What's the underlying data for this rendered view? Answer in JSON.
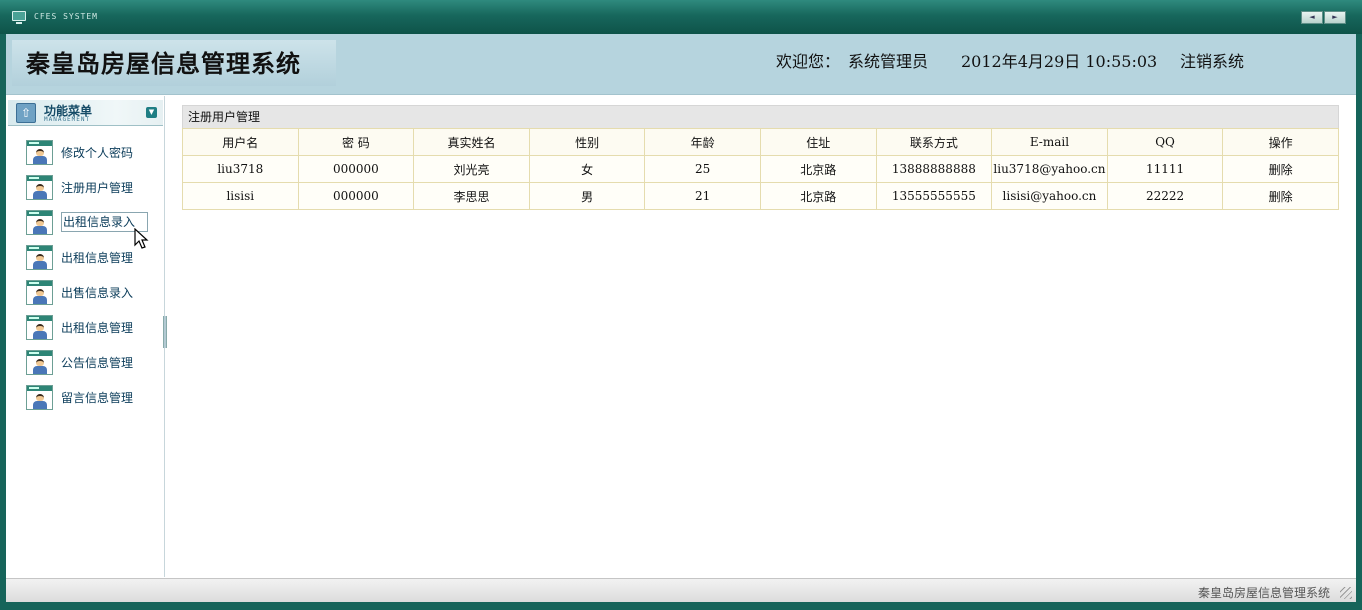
{
  "titlebar": {
    "system_name": "CFES SYSTEM",
    "prev": "◄",
    "next": "►"
  },
  "header": {
    "app_title": "秦皇岛房屋信息管理系统",
    "welcome_label": "欢迎您：",
    "user_name": "系统管理员",
    "datetime": "2012年4月29日  10:55:03",
    "logout": "注销系统"
  },
  "sidebar": {
    "menu_title": "功能菜单",
    "menu_subtitle": "MANAGEMENT",
    "items": [
      {
        "label": "修改个人密码"
      },
      {
        "label": "注册用户管理"
      },
      {
        "label": "出租信息录入"
      },
      {
        "label": "出租信息管理"
      },
      {
        "label": "出售信息录入"
      },
      {
        "label": "出租信息管理"
      },
      {
        "label": "公告信息管理"
      },
      {
        "label": "留言信息管理"
      }
    ]
  },
  "main": {
    "panel_title": "注册用户管理",
    "columns": [
      "用户名",
      "密  码",
      "真实姓名",
      "性别",
      "年龄",
      "住址",
      "联系方式",
      "E-mail",
      "QQ",
      "操作"
    ],
    "rows": [
      [
        "liu3718",
        "000000",
        "刘光亮",
        "女",
        "25",
        "北京路",
        "13888888888",
        "liu3718@yahoo.cn",
        "11111",
        "删除"
      ],
      [
        "lisisi",
        "000000",
        "李思思",
        "男",
        "21",
        "北京路",
        "13555555555",
        "lisisi@yahoo.cn",
        "22222",
        "删除"
      ]
    ]
  },
  "footer": {
    "text": "秦皇岛房屋信息管理系统"
  },
  "colors": {
    "frame": "#16645a",
    "header_bg": "#b6d4de",
    "table_border": "#e5dcae",
    "menu_text": "#0b3c5a"
  }
}
